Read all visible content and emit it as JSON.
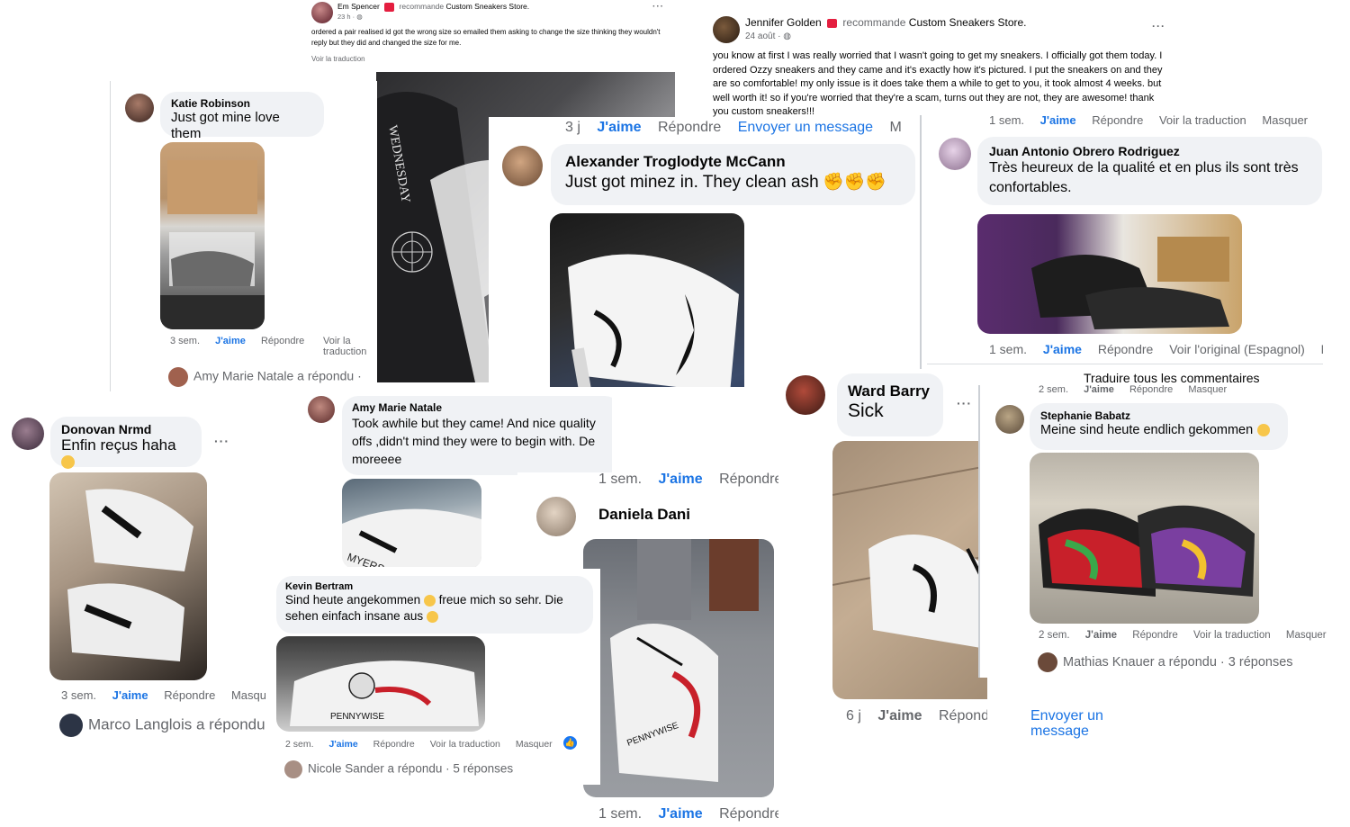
{
  "posts": {
    "em": {
      "author": "Em Spencer",
      "recommends": "recommande",
      "store": "Custom Sneakers Store.",
      "time": "23 h ·",
      "text": "ordered a pair realised id got the wrong size so emailed them asking to change the size thinking they wouldn't reply but they did and changed the size for me.",
      "translate": "Voir la traduction"
    },
    "jennifer": {
      "author": "Jennifer Golden",
      "recommends": "recommande",
      "store": "Custom Sneakers Store.",
      "time": "24 août ·",
      "text": "you know at first I was really worried that I wasn't going to get my sneakers. I officially got them today. I ordered Ozzy sneakers and they came and it's exactly how it's pictured. I put the sneakers on and they are so comfortable! my only issue is it does take them a while to get to you, it took almost 4 weeks. but well worth it! so if you're worried that they're a scam, turns out they are not, they are awesome! thank you custom sneakers!!!"
    }
  },
  "comments": {
    "katie": {
      "name": "Katie Robinson",
      "text": "Just got mine love them",
      "time": "3 sem.",
      "like": "J'aime",
      "reply": "Répondre",
      "translate": "Voir la traduction",
      "replied": "Amy Marie Natale a répondu ·"
    },
    "alexander": {
      "name": "Alexander Troglodyte McCann",
      "text": "Just got minez in. They clean ash",
      "top_time": "3 j",
      "top_like": "J'aime",
      "top_reply": "Répondre",
      "top_message": "Envoyer un message",
      "top_more": "M"
    },
    "juan": {
      "name": "Juan Antonio Obrero Rodriguez",
      "text": "Très heureux de la qualité et en plus ils sont très confortables.",
      "time": "1 sem.",
      "like": "J'aime",
      "reply": "Répondre",
      "original": "Voir l'original (Espagnol)",
      "more": "M",
      "top_time": "1 sem.",
      "top_like": "J'aime",
      "top_reply": "Répondre",
      "top_translate": "Voir la traduction",
      "top_hide": "Masquer",
      "translate_all": "Traduire tous les commentaires"
    },
    "donovan": {
      "name": "Donovan Nrmd",
      "text": "Enfin reçus haha",
      "time": "3 sem.",
      "like": "J'aime",
      "reply": "Répondre",
      "hide": "Masqu",
      "replied": "Marco Langlois a répondu"
    },
    "amy": {
      "name": "Amy Marie Natale",
      "text": "Took awhile but they came! And nice quality offs ,didn't mind they were to begin with. De moreeee"
    },
    "kevin": {
      "name": "Kevin Bertram",
      "text1": "Sind heute angekommen",
      "text2": "freue mich so sehr. Die",
      "text3": "sehen einfach insane aus",
      "time": "2 sem.",
      "like": "J'aime",
      "reply": "Répondre",
      "translate": "Voir la traduction",
      "hide": "Masquer",
      "replied": "Nicole Sander a répondu · 5 réponses"
    },
    "daniela": {
      "name": "Daniela Dani",
      "top_time": "1 sem.",
      "top_like": "J'aime",
      "top_reply": "Répondre",
      "time": "1 sem.",
      "like": "J'aime",
      "reply": "Répondre"
    },
    "ward": {
      "name": "Ward Barry",
      "text": "Sick",
      "time": "6 j",
      "like": "J'aime",
      "reply": "Répondre",
      "message": "Envoyer un message"
    },
    "stephanie": {
      "name": "Stephanie Babatz",
      "text": "Meine sind heute endlich gekommen",
      "time": "2 sem.",
      "like": "J'aime",
      "reply": "Répondre",
      "translate": "Voir la traduction",
      "hide": "Masquer",
      "top_time": "2 sem.",
      "top_like": "J'aime",
      "top_reply": "Répondre",
      "top_hide": "Masquer",
      "replied": "Mathias Knauer a répondu · 3 réponses"
    }
  },
  "icons": {
    "more": "more-options-icon",
    "verified": "recommend-badge-icon",
    "globe": "globe-icon",
    "like_reaction": "like-reaction-icon"
  },
  "colors": {
    "link_blue": "#1b74e4",
    "meta_grey": "#65676b",
    "bubble_grey": "#f0f2f5"
  }
}
